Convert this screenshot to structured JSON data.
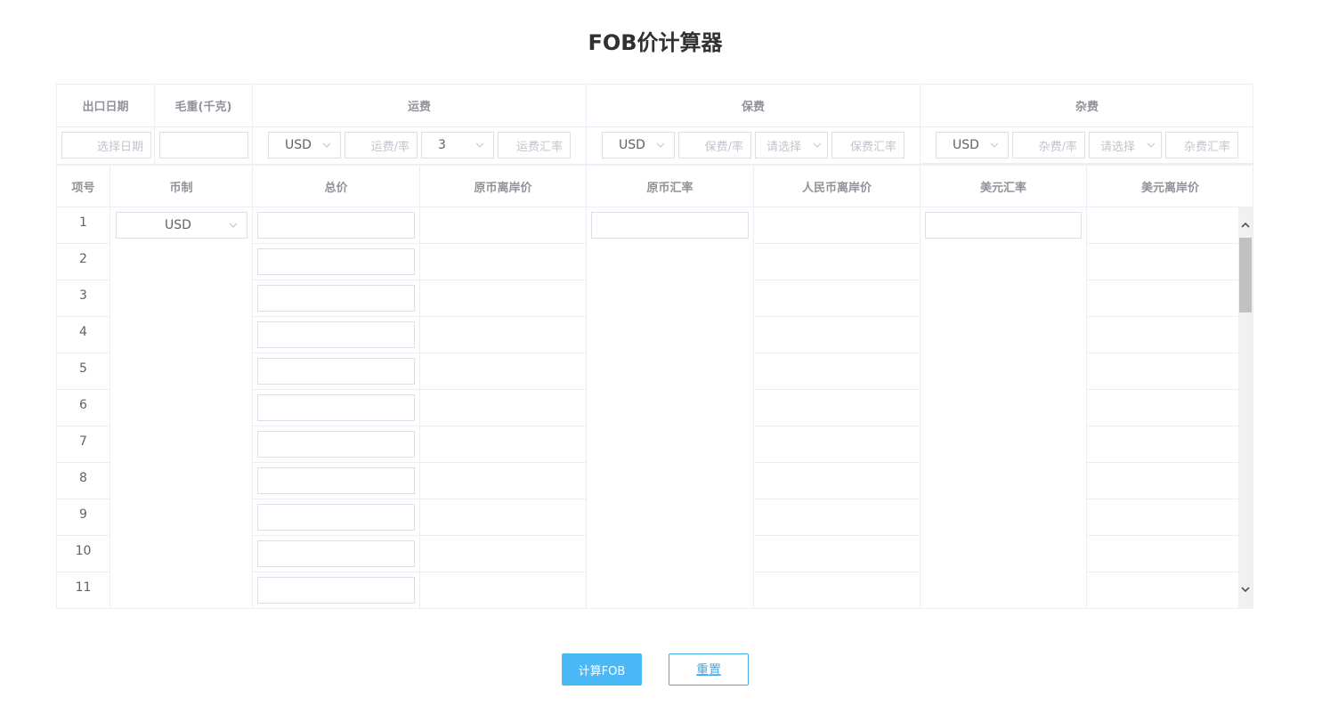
{
  "title": "FOB价计算器",
  "top_headers": {
    "export_date": "出口日期",
    "gross_weight": "毛重(千克)",
    "freight": "运费",
    "insurance": "保费",
    "misc": "杂费"
  },
  "top_inputs": {
    "date_placeholder": "选择日期",
    "freight_currency": "USD",
    "freight_rate_placeholder": "运费/率",
    "freight_mode": "3",
    "freight_fx_placeholder": "运费汇率",
    "insurance_currency": "USD",
    "insurance_rate_placeholder": "保费/率",
    "insurance_mode_placeholder": "请选择",
    "insurance_fx_placeholder": "保费汇率",
    "misc_currency": "USD",
    "misc_rate_placeholder": "杂费/率",
    "misc_mode_placeholder": "请选择",
    "misc_fx_placeholder": "杂费汇率"
  },
  "table_headers": {
    "item_no": "项号",
    "currency": "币制",
    "total_price": "总价",
    "orig_fob": "原币离岸价",
    "orig_fx": "原币汇率",
    "cny_fob": "人民币离岸价",
    "usd_fx": "美元汇率",
    "usd_fob": "美元离岸价"
  },
  "row_currency": "USD",
  "rows": [
    "1",
    "2",
    "3",
    "4",
    "5",
    "6",
    "7",
    "8",
    "9",
    "10",
    "11"
  ],
  "buttons": {
    "calculate": "计算FOB",
    "reset": "重置"
  }
}
